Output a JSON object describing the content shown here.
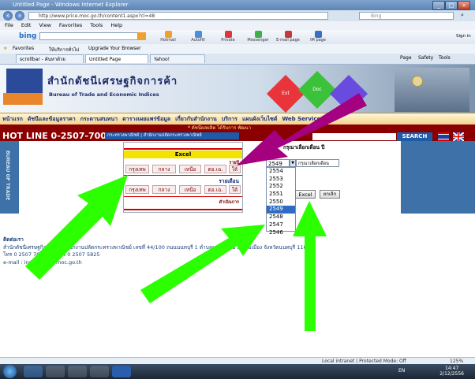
{
  "window": {
    "title": "Untitled Page - Windows Internet Explorer"
  },
  "address": {
    "url": "http://www.price.moc.go.th/content1.aspx?cl=48",
    "search_provider": "Bing"
  },
  "menubar": {
    "items": [
      "File",
      "Edit",
      "View",
      "Favorites",
      "Tools",
      "Help"
    ]
  },
  "bing_toolbar": {
    "logo": "bing",
    "items": [
      "Hotmail",
      "Autofill",
      "Private",
      "Messenger",
      "E-mail page",
      "IM page"
    ],
    "sign_in": "Sign in"
  },
  "favorites_bar": {
    "favorites_label": "Favorites",
    "links": [
      "ให้บริการทั่วไป",
      "Upgrade Your Browser"
    ]
  },
  "tabs": [
    {
      "label": "scrollbar - ค้นหาด้วย Google"
    },
    {
      "label": "Untitled Page"
    },
    {
      "label": "Yahoo!"
    }
  ],
  "command_bar": {
    "items": [
      "Page",
      "Safety",
      "Tools"
    ]
  },
  "site": {
    "org_name_thai": "สำนักดัชนีเศรษฐกิจการค้า",
    "org_name_en": "Bureau of Trade and Economic Indices",
    "cubes": [
      "Ext",
      "Doc",
      ""
    ],
    "nav": [
      "หน้าแรก",
      "ดัชนีและข้อมูลราคา",
      "กระดานสนทนา",
      "ตารางเผยแพร่ข้อมูล",
      "เกี่ยวกับสำนักงาน",
      "บริการ",
      "แผนผังเว็บไซต์",
      "Web Services"
    ],
    "ticker": "* ดัชนีผลผลิต ได้รับการ พัฒนา",
    "hotline": "HOT LINE 0-2507-7000",
    "subtitle": "กระทรวงพาณิชย์ | สำนักงานปลัดกระทรวงพาณิชย์",
    "search_button": "SEARCH",
    "side_text": "BUREAU OF TRADE"
  },
  "excel_panel": {
    "header": "Excel",
    "row1_label": "รายปี",
    "row1_buttons": [
      "กรุงเทพ",
      "กลาง",
      "เหนือ",
      "ตอ.เฉ.",
      "ใต้"
    ],
    "row2_label": "รายเดือน",
    "row2_buttons": [
      "กรุงเทพ",
      "กลาง",
      "เหนือ",
      "ตอ.เฉ.",
      "ใต้"
    ],
    "row3_label": "ดำเนินการ"
  },
  "year_selector": {
    "title": "กรุณาเลือกเดือน ปี",
    "selected_year": "2549",
    "selected_month": "กรุณาเลือกเดือน",
    "options": [
      "2554",
      "2553",
      "2552",
      "2551",
      "2550",
      "2549",
      "2548",
      "2547",
      "2546"
    ],
    "highlighted": "2549",
    "excel_button": "Excel",
    "cancel_button": "ยกเลิก"
  },
  "contact": {
    "heading": "ติดต่อเรา",
    "address": "สำนักดัชนีเศรษฐกิจการค้า สำนักงานปลัดกระทรวงพาณิชย์ เลขที่ 44/100 ถนนนนทบุรี 1 ตำบลบางกระสอ อำเภอเมือง จังหวัดนนทบุรี 11000",
    "phone": "โทร 0 2507 7000  โทรสาร 0 2507 5825",
    "email": "e-mail : indexprice@moc.go.th"
  },
  "statusbar": {
    "zone": "Local intranet | Protected Mode: Off",
    "zoom": "125%"
  },
  "taskbar": {
    "lang": "EN",
    "time": "14:47",
    "date": "2/12/2556"
  },
  "colors": {
    "arrow_green": "#2bff00",
    "arrow_purple": "#a4007f",
    "site_red": "#8a0000",
    "site_blue": "#3d71a8",
    "excel_yellow": "#f5e200"
  }
}
